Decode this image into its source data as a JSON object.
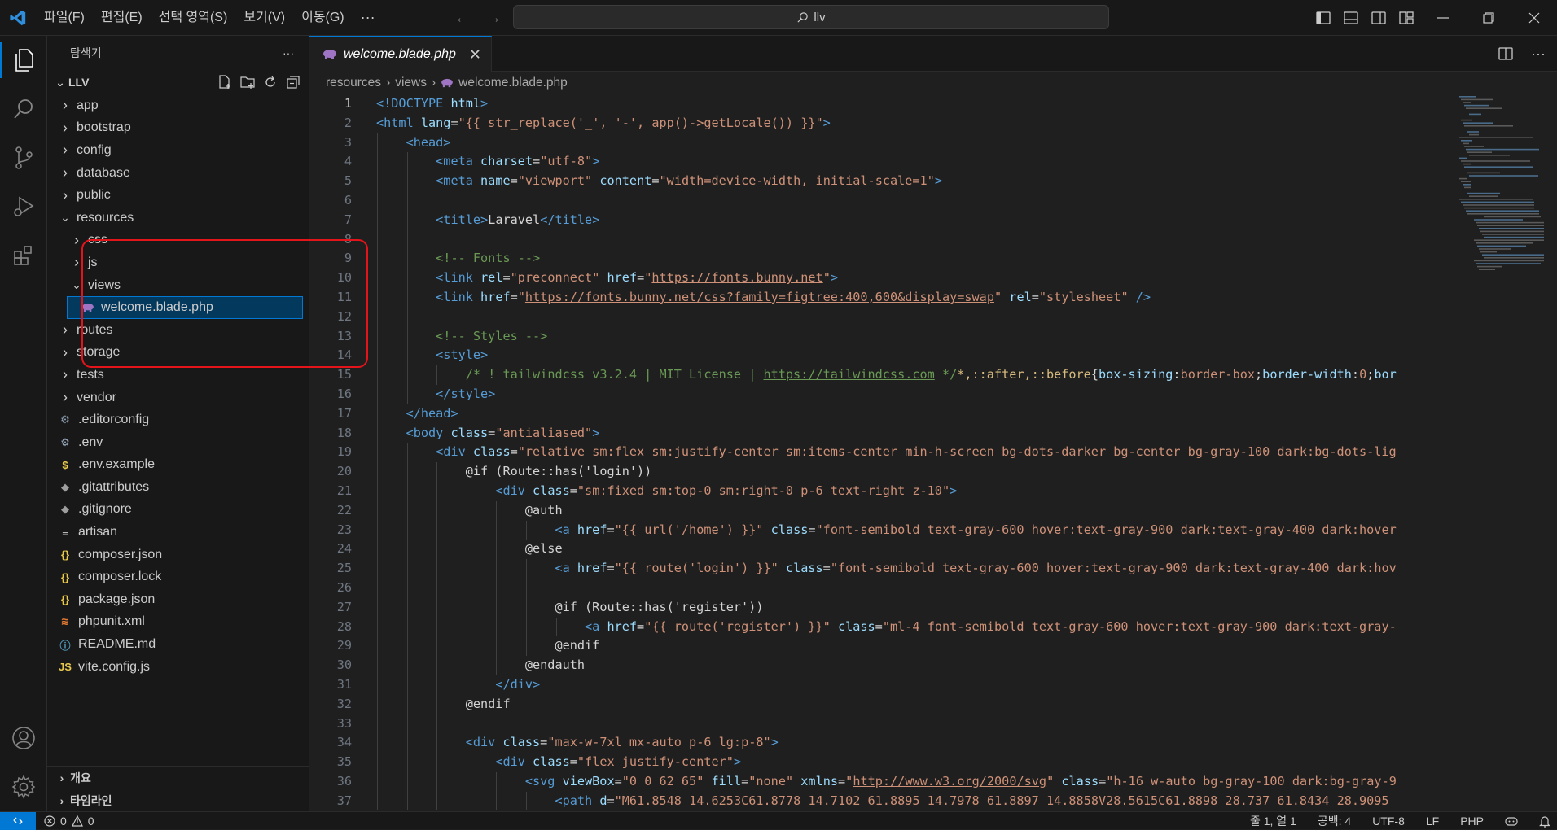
{
  "titlebar": {
    "menu": [
      "파일(F)",
      "편집(E)",
      "선택 영역(S)",
      "보기(V)",
      "이동(G)"
    ],
    "more": "···",
    "search_text": "llv"
  },
  "sidebar": {
    "title": "탐색기",
    "more": "···",
    "project": "LLV",
    "tree": [
      {
        "label": "app",
        "kind": "folder",
        "depth": 0,
        "open": false
      },
      {
        "label": "bootstrap",
        "kind": "folder",
        "depth": 0,
        "open": false
      },
      {
        "label": "config",
        "kind": "folder",
        "depth": 0,
        "open": false
      },
      {
        "label": "database",
        "kind": "folder",
        "depth": 0,
        "open": false
      },
      {
        "label": "public",
        "kind": "folder",
        "depth": 0,
        "open": false
      },
      {
        "label": "resources",
        "kind": "folder",
        "depth": 0,
        "open": true
      },
      {
        "label": "css",
        "kind": "folder",
        "depth": 1,
        "open": false
      },
      {
        "label": "js",
        "kind": "folder",
        "depth": 1,
        "open": false
      },
      {
        "label": "views",
        "kind": "folder",
        "depth": 1,
        "open": true
      },
      {
        "label": "welcome.blade.php",
        "kind": "file",
        "icon": "php-elephant-icon",
        "depth": 2,
        "selected": true
      },
      {
        "label": "routes",
        "kind": "folder",
        "depth": 0,
        "open": false
      },
      {
        "label": "storage",
        "kind": "folder",
        "depth": 0,
        "open": false
      },
      {
        "label": "tests",
        "kind": "folder",
        "depth": 0,
        "open": false
      },
      {
        "label": "vendor",
        "kind": "folder",
        "depth": 0,
        "open": false
      },
      {
        "label": ".editorconfig",
        "kind": "file",
        "icon": "gear-icon",
        "depth": 0
      },
      {
        "label": ".env",
        "kind": "file",
        "icon": "gear-icon",
        "depth": 0
      },
      {
        "label": ".env.example",
        "kind": "file",
        "icon": "dollar-icon",
        "depth": 0
      },
      {
        "label": ".gitattributes",
        "kind": "file",
        "icon": "git-icon",
        "depth": 0
      },
      {
        "label": ".gitignore",
        "kind": "file",
        "icon": "git-icon",
        "depth": 0
      },
      {
        "label": "artisan",
        "kind": "file",
        "icon": "lines-icon",
        "depth": 0
      },
      {
        "label": "composer.json",
        "kind": "file",
        "icon": "json-icon",
        "depth": 0
      },
      {
        "label": "composer.lock",
        "kind": "file",
        "icon": "json-icon",
        "depth": 0
      },
      {
        "label": "package.json",
        "kind": "file",
        "icon": "json-icon",
        "depth": 0
      },
      {
        "label": "phpunit.xml",
        "kind": "file",
        "icon": "rss-icon",
        "depth": 0
      },
      {
        "label": "README.md",
        "kind": "file",
        "icon": "info-icon",
        "depth": 0
      },
      {
        "label": "vite.config.js",
        "kind": "file",
        "icon": "js-icon",
        "depth": 0
      }
    ],
    "bottom_sections": [
      "개요",
      "타임라인"
    ]
  },
  "editor": {
    "tab_label": "welcome.blade.php",
    "breadcrumb": [
      "resources",
      "views",
      "welcome.blade.php"
    ],
    "current_line": 1
  },
  "statusbar": {
    "errors": "0",
    "warnings": "0",
    "position": "줄 1, 열 1",
    "spaces": "공백: 4",
    "encoding": "UTF-8",
    "eol": "LF",
    "language": "PHP"
  },
  "colors": {
    "accent": "#0078d4",
    "highlight_box": "#e5141b",
    "folder_chevron": "#cccccc",
    "json_icon": "#e8c94b",
    "php_icon": "#a074c4"
  }
}
